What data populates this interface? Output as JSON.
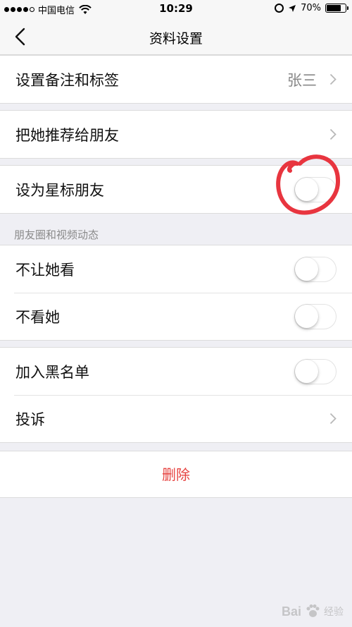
{
  "status_bar": {
    "carrier": "中国电信",
    "time": "10:29",
    "battery": "70%"
  },
  "nav": {
    "title": "资料设置"
  },
  "rows": {
    "remark": {
      "label": "设置备注和标签",
      "value": "张三"
    },
    "recommend": {
      "label": "把她推荐给朋友"
    },
    "star": {
      "label": "设为星标朋友"
    },
    "hide_moments": {
      "label": "不让她看"
    },
    "no_view": {
      "label": "不看她"
    },
    "blacklist": {
      "label": "加入黑名单"
    },
    "report": {
      "label": "投诉"
    }
  },
  "section": {
    "moments_header": "朋友圈和视频动态"
  },
  "delete_label": "删除",
  "watermark": {
    "brand": "Bai",
    "sub": "经验"
  },
  "colors": {
    "accent_red": "#e64340",
    "annotation": "#e8353f",
    "background": "#efeff4"
  }
}
